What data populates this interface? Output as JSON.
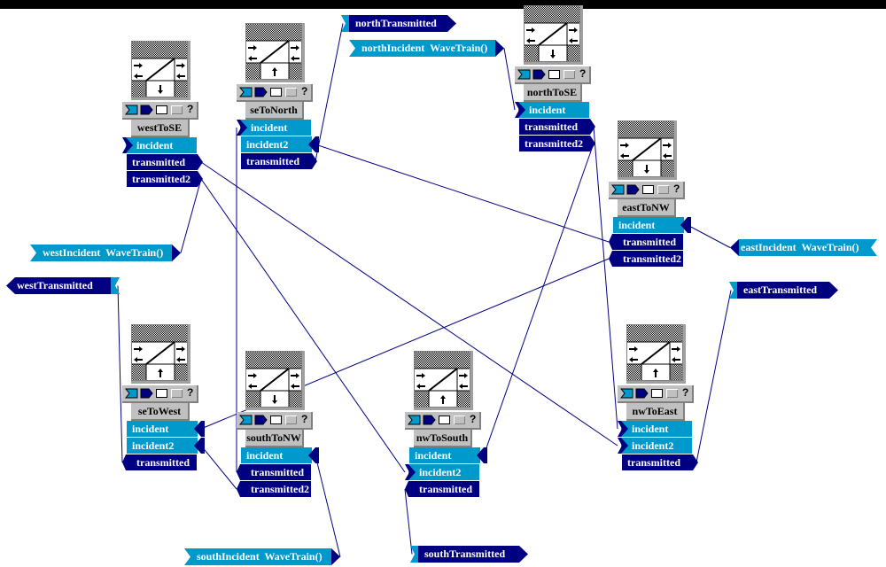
{
  "colors": {
    "incident": "#0099cc",
    "transmitted": "#000080",
    "wire": "#000080",
    "panel": "#c0c0c0",
    "background": "#ffffff"
  },
  "toolbar_icons": [
    "input-port-icon",
    "output-port-icon",
    "hollow-box-icon",
    "gray-box-icon",
    "help-icon"
  ],
  "toolbar_help": "?",
  "modules": [
    {
      "name": "westToSE",
      "arrow": "down",
      "ports": [
        {
          "label": "incident",
          "kind": "in"
        },
        {
          "label": "transmitted",
          "kind": "out"
        },
        {
          "label": "transmitted2",
          "kind": "out"
        }
      ]
    },
    {
      "name": "seToNorth",
      "arrow": "up",
      "ports": [
        {
          "label": "incident",
          "kind": "in"
        },
        {
          "label": "incident2",
          "kind": "in"
        },
        {
          "label": "transmitted",
          "kind": "out"
        }
      ]
    },
    {
      "name": "northToSE",
      "arrow": "down",
      "ports": [
        {
          "label": "incident",
          "kind": "in"
        },
        {
          "label": "transmitted",
          "kind": "out"
        },
        {
          "label": "transmitted2",
          "kind": "out"
        }
      ]
    },
    {
      "name": "eastToNW",
      "arrow": "down",
      "ports": [
        {
          "label": "incident",
          "kind": "in"
        },
        {
          "label": "transmitted",
          "kind": "out"
        },
        {
          "label": "transmitted2",
          "kind": "out"
        }
      ]
    },
    {
      "name": "seToWest",
      "arrow": "up",
      "ports": [
        {
          "label": "incident",
          "kind": "in"
        },
        {
          "label": "incident2",
          "kind": "in"
        },
        {
          "label": "transmitted",
          "kind": "out"
        }
      ]
    },
    {
      "name": "southToNW",
      "arrow": "down",
      "ports": [
        {
          "label": "incident",
          "kind": "in"
        },
        {
          "label": "transmitted",
          "kind": "out"
        },
        {
          "label": "transmitted2",
          "kind": "out"
        }
      ]
    },
    {
      "name": "nwToSouth",
      "arrow": "up",
      "ports": [
        {
          "label": "incident",
          "kind": "in"
        },
        {
          "label": "incident2",
          "kind": "in"
        },
        {
          "label": "transmitted",
          "kind": "out"
        }
      ]
    },
    {
      "name": "nwToEast",
      "arrow": "up",
      "ports": [
        {
          "label": "incident",
          "kind": "in"
        },
        {
          "label": "incident2",
          "kind": "in"
        },
        {
          "label": "transmitted",
          "kind": "out"
        }
      ]
    }
  ],
  "sources": [
    {
      "id": "north",
      "label": "northIncident  WaveTrain()"
    },
    {
      "id": "west",
      "label": "westIncident  WaveTrain()"
    },
    {
      "id": "east",
      "label": "eastIncident  WaveTrain()"
    },
    {
      "id": "south",
      "label": "southIncident  WaveTrain()"
    }
  ],
  "sinks": [
    {
      "id": "north",
      "label": "northTransmitted"
    },
    {
      "id": "west",
      "label": "westTransmitted"
    },
    {
      "id": "east",
      "label": "eastTransmitted"
    },
    {
      "id": "south",
      "label": "southTransmitted"
    }
  ],
  "connections": [
    {
      "from": "westToSE.transmitted",
      "to": "nwToEast.incident2"
    },
    {
      "from": "westToSE.transmitted2",
      "to": "nwToSouth.incident2"
    },
    {
      "from": "westToSE.transmitted2",
      "to": "source.west"
    },
    {
      "from": "seToNorth.transmitted",
      "to": "sink.north"
    },
    {
      "from": "eastToNW.transmitted",
      "to": "seToNorth.incident2"
    },
    {
      "from": "source.north",
      "to": "northToSE.incident"
    },
    {
      "from": "northToSE.transmitted",
      "to": "nwToEast.incident"
    },
    {
      "from": "northToSE.transmitted2",
      "to": "nwToSouth.incident"
    },
    {
      "from": "source.east",
      "to": "eastToNW.incident"
    },
    {
      "from": "eastToNW.transmitted2",
      "to": "seToWest.incident"
    },
    {
      "from": "nwToEast.transmitted",
      "to": "sink.east"
    },
    {
      "from": "sink.west",
      "to": "seToWest.transmitted"
    },
    {
      "from": "seToWest.incident2",
      "to": "southToNW.transmitted2"
    },
    {
      "from": "southToNW.transmitted",
      "to": "seToNorth.incident"
    },
    {
      "from": "southToNW.incident",
      "to": "source.south"
    },
    {
      "from": "nwToSouth.transmitted",
      "to": "sink.south"
    }
  ]
}
